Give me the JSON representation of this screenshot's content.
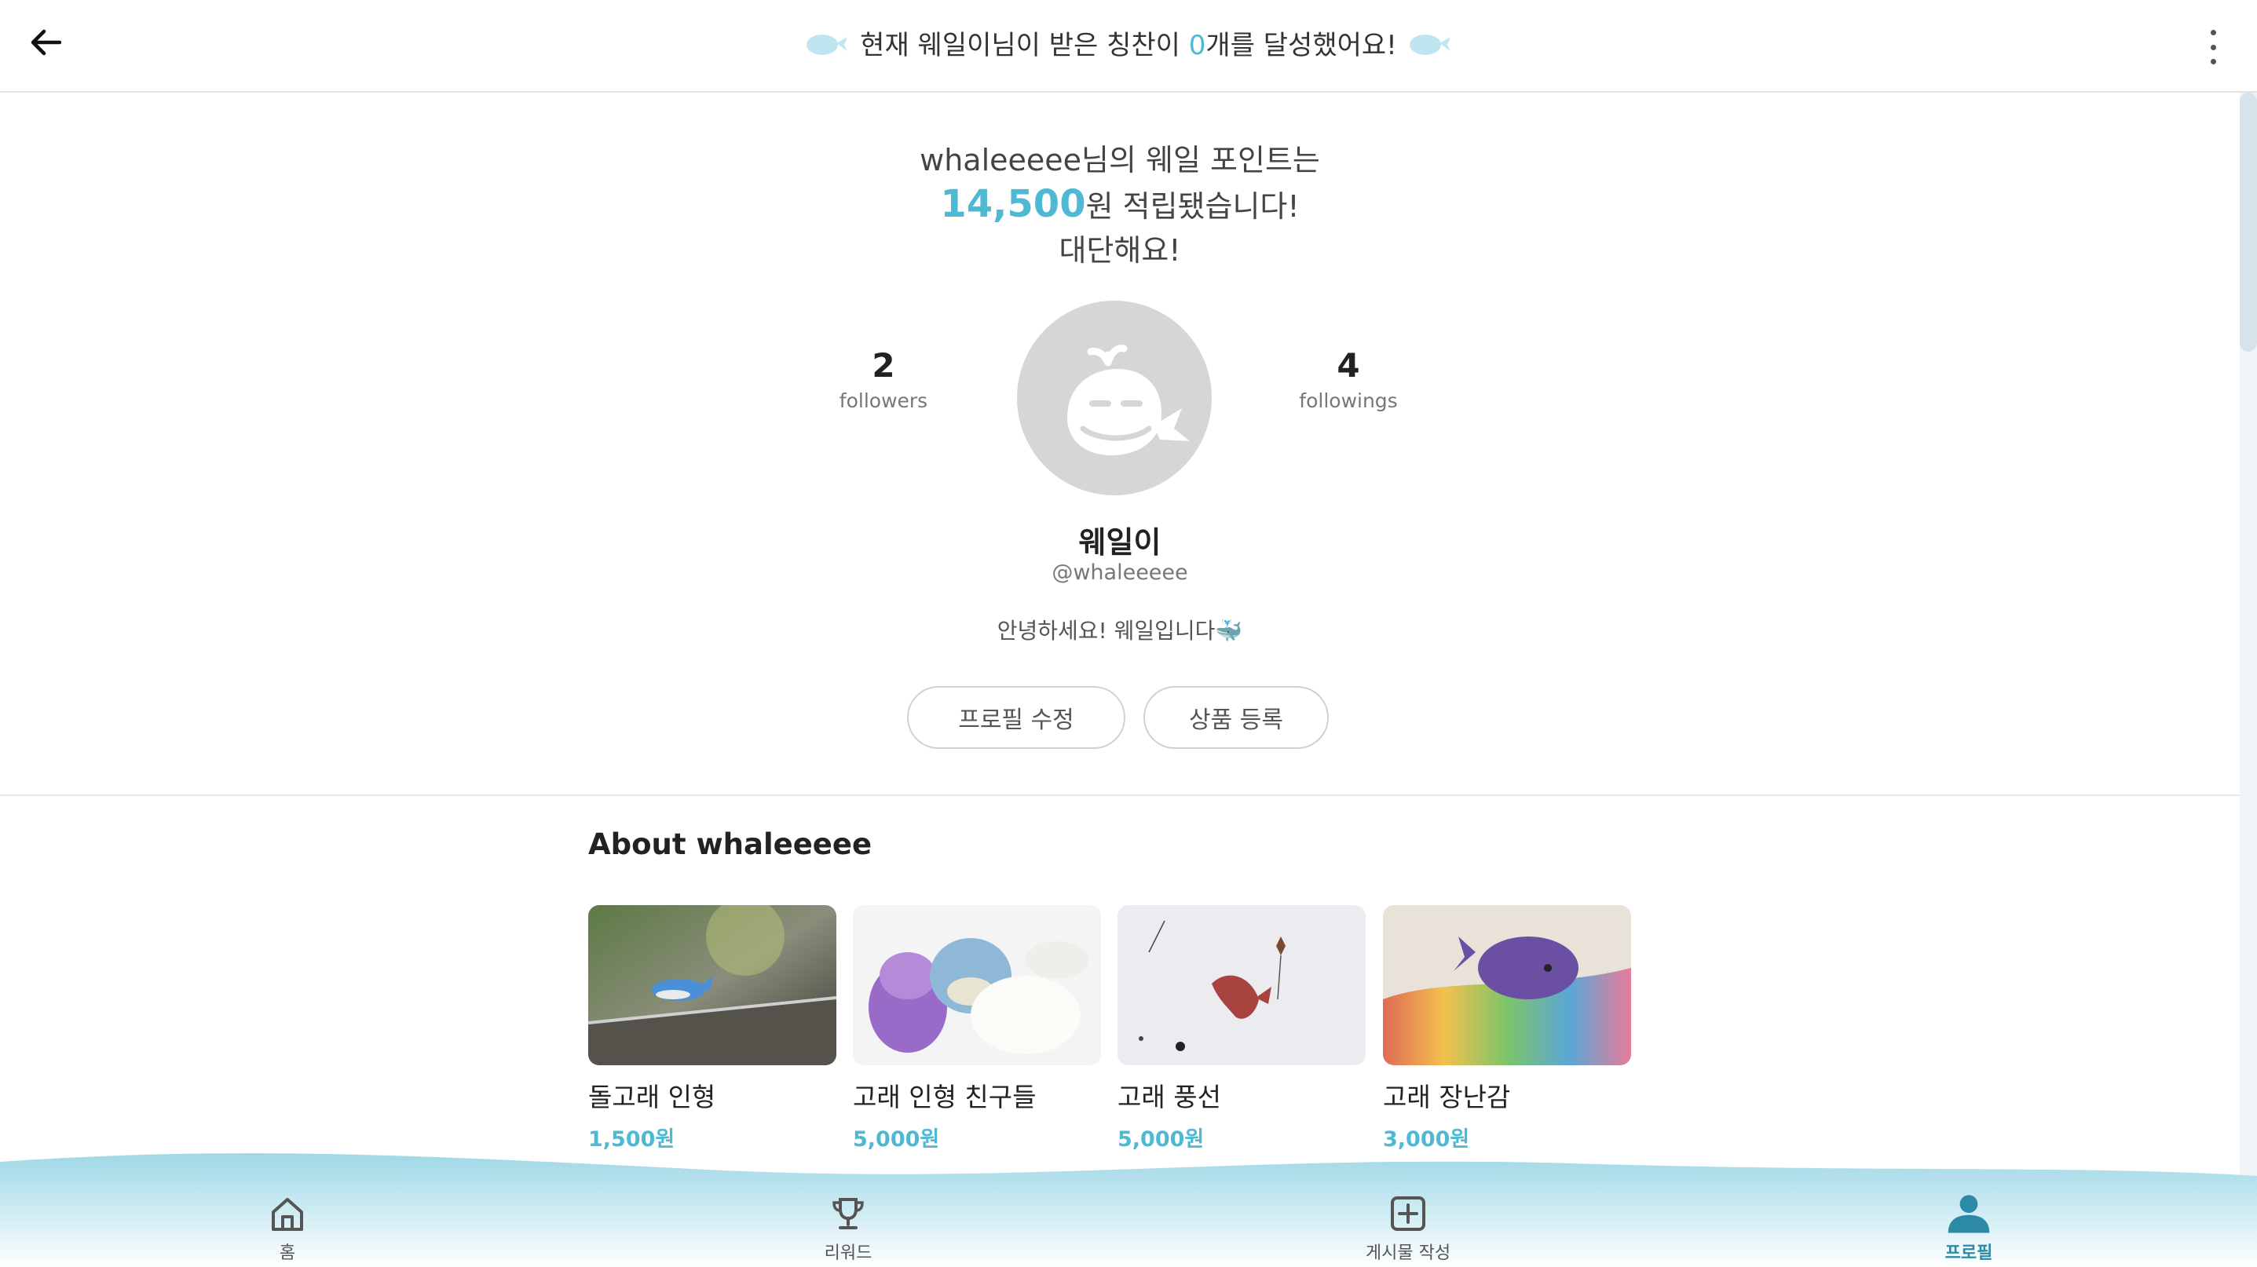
{
  "header": {
    "back_icon": "arrow-left-icon",
    "message_prefix": "현재 웨일이님이 받은 칭찬이 ",
    "message_count": "0",
    "message_suffix": "개를 달성했어요!",
    "menu_icon": "more-vertical-icon"
  },
  "points": {
    "line1": "whaleeeee님의 웨일 포인트는",
    "amount": "14,500",
    "line2_suffix": "원 적립됐습니다!",
    "line3": "대단해요!"
  },
  "profile": {
    "followers_count": "2",
    "followers_label": "followers",
    "followings_count": "4",
    "followings_label": "followings",
    "name": "웨일이",
    "handle": "@whaleeeee",
    "bio": "안녕하세요! 웨일입니다🐳",
    "edit_button": "프로필 수정",
    "register_button": "상품 등록"
  },
  "about": {
    "title": "About whaleeeee",
    "products": [
      {
        "name": "돌고래 인형",
        "price": "1,500원"
      },
      {
        "name": "고래 인형 친구들",
        "price": "5,000원"
      },
      {
        "name": "고래 풍선",
        "price": "5,000원"
      },
      {
        "name": "고래 장난감",
        "price": "3,000원"
      }
    ]
  },
  "nav": {
    "items": [
      {
        "label": "홈",
        "icon": "home-icon"
      },
      {
        "label": "리워드",
        "icon": "trophy-icon"
      },
      {
        "label": "게시물 작성",
        "icon": "plus-square-icon"
      },
      {
        "label": "프로필",
        "icon": "user-icon",
        "active": true
      }
    ]
  },
  "colors": {
    "accent": "#4fb9d3",
    "wave": "#a8dce8",
    "avatar_bg": "#d6d6d6"
  }
}
